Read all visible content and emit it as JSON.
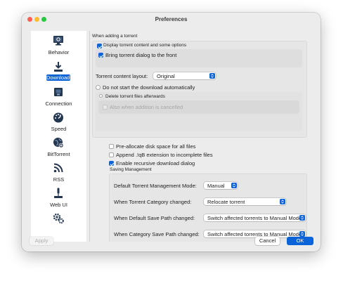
{
  "window": {
    "title": "Preferences"
  },
  "colors": {
    "accent": "#0a64d8",
    "close": "#fe5f57",
    "minimize": "#febc2e",
    "zoom": "#28c840"
  },
  "sidebar": {
    "items": [
      {
        "label": "Behavior",
        "icon": "monitor-icon"
      },
      {
        "label": "Downloads",
        "icon": "download-icon",
        "selected": true
      },
      {
        "label": "Connection",
        "icon": "connection-icon"
      },
      {
        "label": "Speed",
        "icon": "speedometer-icon"
      },
      {
        "label": "BitTorrent",
        "icon": "globe-icon"
      },
      {
        "label": "RSS",
        "icon": "rss-icon"
      },
      {
        "label": "Web UI",
        "icon": "web-ui-icon"
      },
      {
        "label": "",
        "icon": "gears-icon"
      }
    ]
  },
  "adding": {
    "section_title": "When adding a torrent",
    "display_content": {
      "label": "Display torrent content and some options",
      "checked": true
    },
    "bring_front": {
      "label": "Bring torrent dialog to the front",
      "checked": true
    },
    "layout_label": "Torrent content layout:",
    "layout_value": "Original",
    "no_autostart": {
      "label": "Do not start the download automatically",
      "checked": false
    },
    "delete_files": {
      "label": "Delete torrent files afterwards",
      "checked": false
    },
    "also_cancelled": {
      "label": "Also when addition is cancelled",
      "checked": false,
      "disabled": true
    }
  },
  "options": {
    "preallocate": {
      "label": "Pre-allocate disk space for all files",
      "checked": false
    },
    "append_ext": {
      "label": "Append .!qB extension to incomplete files",
      "checked": false
    },
    "recursive": {
      "label": "Enable recursive download dialog",
      "checked": true
    }
  },
  "saving": {
    "section_title": "Saving Management",
    "rows": [
      {
        "label": "Default Torrent Management Mode:",
        "value": "Manual"
      },
      {
        "label": "When Torrent Category changed:",
        "value": "Relocate torrent"
      },
      {
        "label": "When Default Save Path changed:",
        "value": "Switch affected torrents to Manual Mode"
      },
      {
        "label": "When Category Save Path changed:",
        "value": "Switch affected torrents to Manual Mode"
      }
    ]
  },
  "footer": {
    "apply": "Apply",
    "cancel": "Cancel",
    "ok": "OK"
  }
}
